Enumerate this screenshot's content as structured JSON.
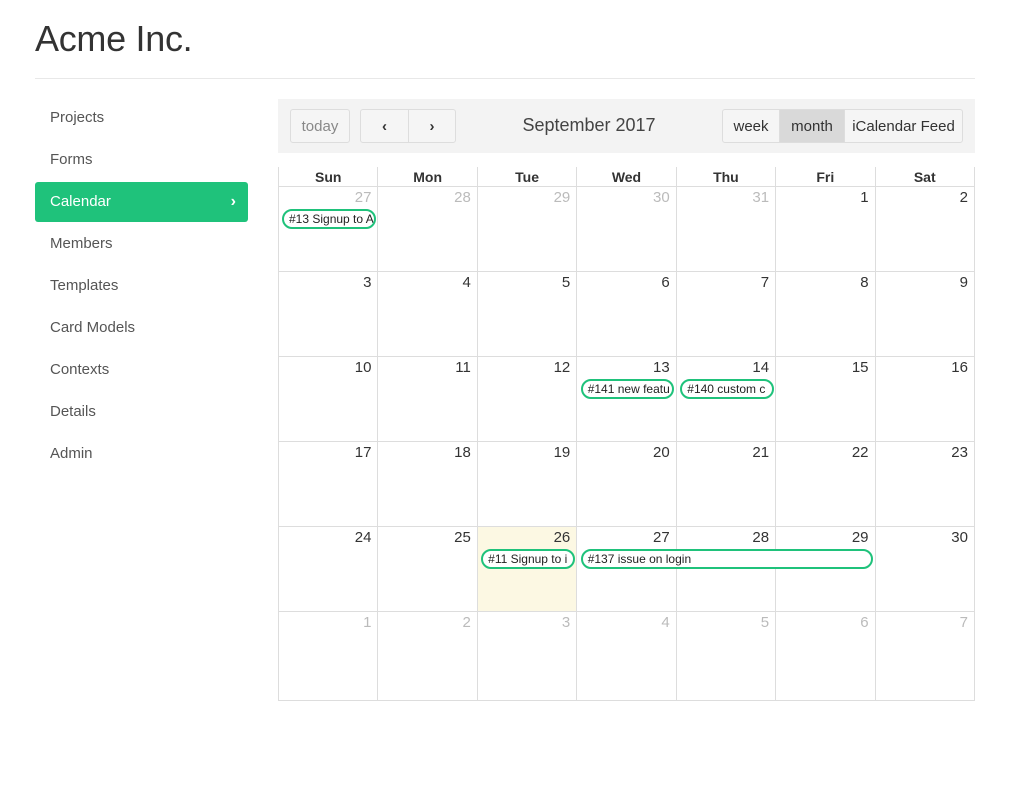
{
  "brand": "Acme Inc.",
  "sidebar": {
    "items": [
      {
        "label": "Projects"
      },
      {
        "label": "Forms"
      },
      {
        "label": "Calendar",
        "active": true
      },
      {
        "label": "Members"
      },
      {
        "label": "Templates"
      },
      {
        "label": "Card Models"
      },
      {
        "label": "Contexts"
      },
      {
        "label": "Details"
      },
      {
        "label": "Admin"
      }
    ]
  },
  "calendar": {
    "title": "September 2017",
    "buttons": {
      "today": "today",
      "prev": "‹",
      "next": "›",
      "week": "week",
      "month": "month",
      "feed": "iCalendar Feed"
    },
    "active_view": "month",
    "weekdays": [
      "Sun",
      "Mon",
      "Tue",
      "Wed",
      "Thu",
      "Fri",
      "Sat"
    ],
    "weeks": [
      [
        "27",
        "28",
        "29",
        "30",
        "31",
        "1",
        "2"
      ],
      [
        "3",
        "4",
        "5",
        "6",
        "7",
        "8",
        "9"
      ],
      [
        "10",
        "11",
        "12",
        "13",
        "14",
        "15",
        "16"
      ],
      [
        "17",
        "18",
        "19",
        "20",
        "21",
        "22",
        "23"
      ],
      [
        "24",
        "25",
        "26",
        "27",
        "28",
        "29",
        "30"
      ],
      [
        "1",
        "2",
        "3",
        "4",
        "5",
        "6",
        "7"
      ]
    ],
    "today": "26",
    "events": [
      {
        "label": "#13 Signup to A",
        "week": 0,
        "start": 0,
        "span": 1
      },
      {
        "label": "#141 new featu",
        "week": 2,
        "start": 3,
        "span": 1
      },
      {
        "label": "#140 custom c",
        "week": 2,
        "start": 4,
        "span": 1
      },
      {
        "label": "#11 Signup to i",
        "week": 4,
        "start": 2,
        "span": 1
      },
      {
        "label": "#137 issue on login",
        "week": 4,
        "start": 3,
        "span": 3
      }
    ],
    "colors": {
      "accent": "#1fc27b",
      "today_bg": "#fcf8e3"
    }
  }
}
